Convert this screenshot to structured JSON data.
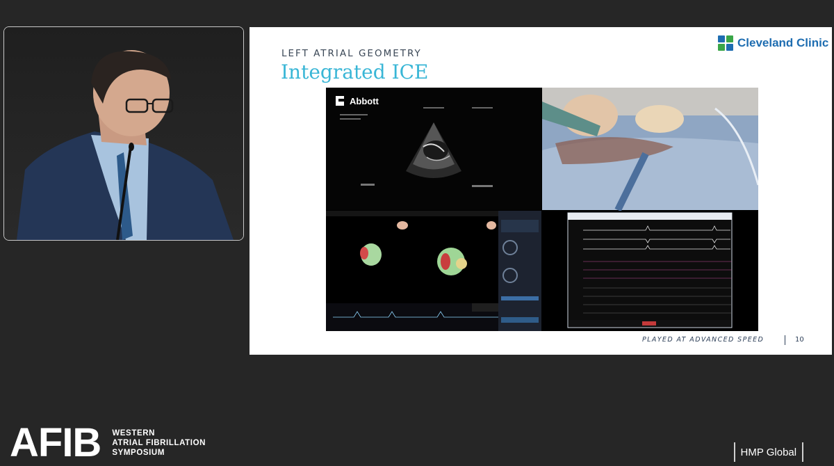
{
  "slide": {
    "kicker": "LEFT ATRIAL GEOMETRY",
    "title": "Integrated ICE",
    "logo_text": "Cleveland Clinic",
    "note": "PLAYED AT ADVANCED SPEED",
    "page_number": "10",
    "colors": {
      "title": "#39b6d6",
      "logo": "#1e6db1"
    }
  },
  "video": {
    "vendor_logo": "Abbott",
    "icons": [
      "abbott-logo-icon"
    ]
  },
  "branding": {
    "event_logo": "AFIB",
    "event_lines": [
      "WESTERN",
      "ATRIAL FIBRILLATION",
      "SYMPOSIUM"
    ],
    "sponsor": "HMP Global"
  }
}
